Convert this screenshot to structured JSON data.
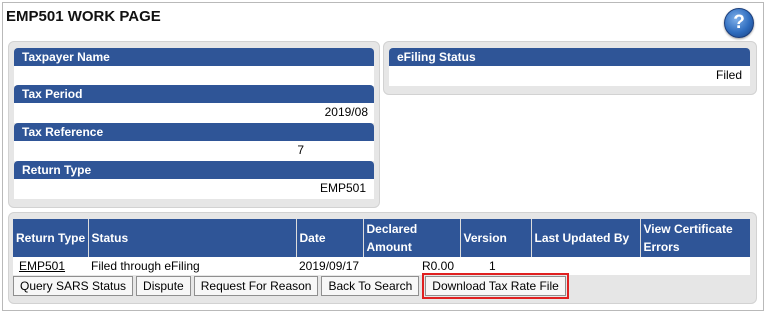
{
  "page": {
    "title": "EMP501 WORK PAGE",
    "help_glyph": "?"
  },
  "details": {
    "taxpayer_name_label": "Taxpayer Name",
    "taxpayer_name_value": "",
    "tax_period_label": "Tax Period",
    "tax_period_value": "2019/08",
    "tax_reference_label": "Tax Reference",
    "tax_reference_value": "7",
    "return_type_label": "Return Type",
    "return_type_value": "EMP501"
  },
  "efiling": {
    "label": "eFiling Status",
    "value": "Filed"
  },
  "returns_table": {
    "headers": [
      "Return Type",
      "Status",
      "Date",
      "Declared Amount",
      "Version",
      "Last Updated By",
      "View Certificate Errors"
    ],
    "rows": [
      {
        "return_type": "EMP501",
        "status": "Filed through eFiling",
        "date": "2019/09/17",
        "declared_amount": "R0.00",
        "version": "1",
        "last_updated_by": "",
        "view_certificate_errors": ""
      }
    ]
  },
  "actions": {
    "query_status": "Query SARS Status",
    "dispute": "Dispute",
    "request_reason": "Request For Reason",
    "back_to_search": "Back To Search",
    "download_tax_rate": "Download Tax Rate File"
  },
  "colors": {
    "header_blue": "#2f5597",
    "panel_grey": "#e6e6e6",
    "highlight_red": "#e02020"
  },
  "icons": {
    "help": "help-icon"
  }
}
